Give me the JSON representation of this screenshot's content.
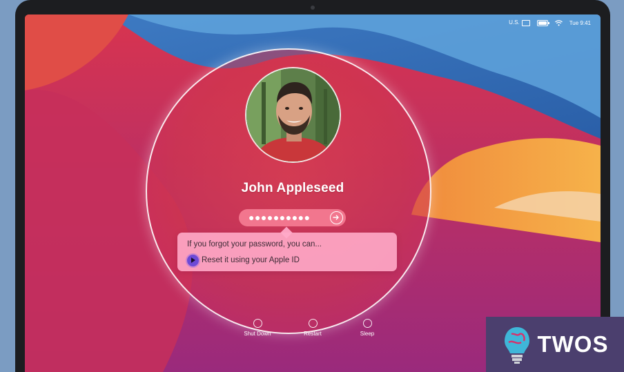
{
  "menubar": {
    "input_source": "U.S.",
    "keyboard_icon": "keyboard-icon",
    "battery_icon": "battery-icon",
    "wifi_icon": "wifi-icon",
    "clock": "Tue 9:41"
  },
  "login": {
    "username": "John Appleseed",
    "password_mask": "●●●●●●●●●●",
    "submit_icon": "arrow-right-circle-icon"
  },
  "hint": {
    "message": "If you forgot your password, you can...",
    "reset_label": "Reset it using your Apple ID",
    "reset_icon": "play-circle-icon"
  },
  "power": {
    "shut_down": "Shut Down",
    "restart": "Restart",
    "sleep": "Sleep"
  },
  "watermark": {
    "text": "TWOS",
    "logo": "brain-bulb-logo"
  },
  "colors": {
    "hint_bg": "#FFAAC8",
    "reset_icon": "#6D4AD6",
    "watermark_bg": "#4B3F6E"
  }
}
